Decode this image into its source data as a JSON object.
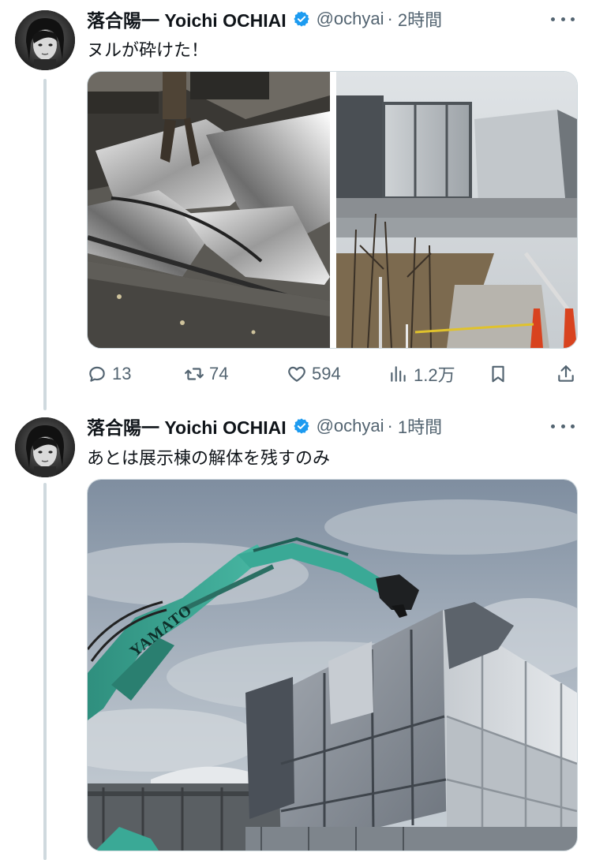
{
  "tweets": [
    {
      "name": "落合陽一 Yoichi OCHIAI",
      "handle": "@ochyai",
      "separator": "·",
      "time": "2時間",
      "text": "ヌルが砕けた！",
      "stats": {
        "replies": "13",
        "retweets": "74",
        "likes": "594",
        "views": "1.2万"
      }
    },
    {
      "name": "落合陽一 Yoichi OCHIAI",
      "handle": "@ochyai",
      "separator": "·",
      "time": "1時間",
      "text": "あとは展示棟の解体を残すのみ",
      "image_lettering": "YAMATO"
    }
  ],
  "icons": {
    "verified": "verified-badge-icon",
    "more": "more-dots-icon",
    "reply": "reply-bubble-icon",
    "retweet": "retweet-icon",
    "like": "heart-icon",
    "views": "views-bar-icon",
    "bookmark": "bookmark-icon",
    "share": "share-upload-icon"
  },
  "colors": {
    "verified": "#1d9bf0",
    "secondary_text": "#536471",
    "thread_line": "#cfd9de",
    "excavator": "#3aa996"
  }
}
